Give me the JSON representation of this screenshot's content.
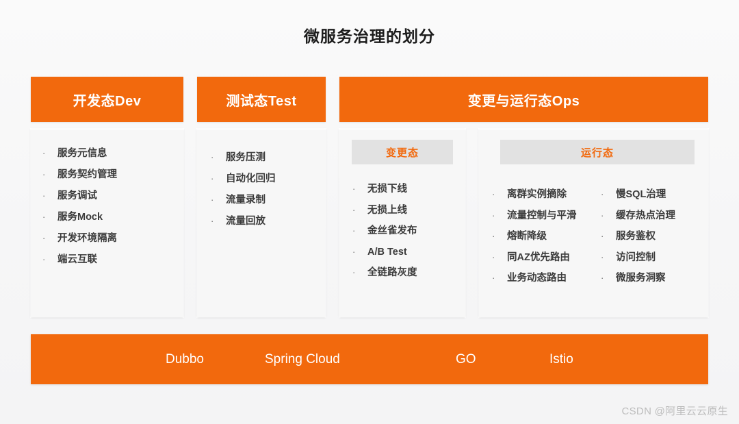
{
  "title": "微服务治理的划分",
  "colors": {
    "accent_orange": "#F2690D",
    "background": "#F7F7F8",
    "card_background": "#F7F7F7",
    "section_label_background": "#E2E2E2",
    "text_dark": "#3B3B3B",
    "watermark": "#BDBDBD"
  },
  "columns": {
    "dev": {
      "header": "开发态Dev",
      "items": [
        "服务元信息",
        "服务契约管理",
        "服务调试",
        "服务Mock",
        "开发环境隔离",
        "端云互联"
      ]
    },
    "test": {
      "header": "测试态Test",
      "items": [
        "服务压测",
        "自动化回归",
        "流量录制",
        "流量回放"
      ]
    },
    "ops": {
      "header": "变更与运行态Ops",
      "change": {
        "label": "变更态",
        "items": [
          "无损下线",
          "无损上线",
          "金丝雀发布",
          "A/B Test",
          "全链路灰度"
        ]
      },
      "run": {
        "label": "运行态",
        "items_left": [
          "离群实例摘除",
          "流量控制与平滑",
          "熔断降级",
          "同AZ优先路由",
          "业务动态路由"
        ],
        "items_right": [
          "慢SQL治理",
          "缓存热点治理",
          "服务鉴权",
          "访问控制",
          "微服务洞察"
        ]
      }
    }
  },
  "footer": {
    "frameworks": [
      "Dubbo",
      "Spring Cloud",
      "GO",
      "Istio"
    ]
  },
  "watermark": "CSDN @阿里云云原生",
  "bullet_glyph": "·"
}
